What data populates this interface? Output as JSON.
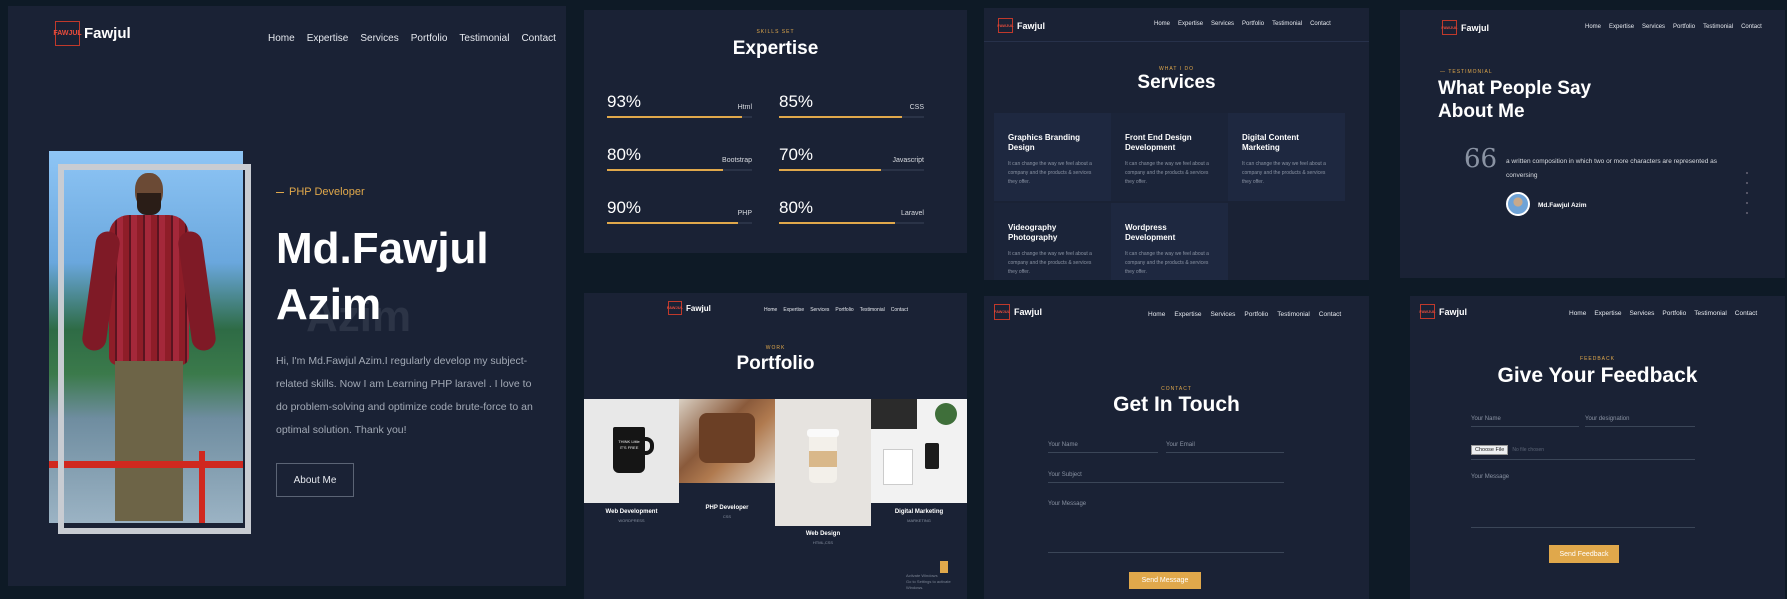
{
  "brand": {
    "logo_mark": "FAWJUL",
    "name": "Fawjul"
  },
  "nav": [
    "Home",
    "Expertise",
    "Services",
    "Portfolio",
    "Testimonial",
    "Contact"
  ],
  "hero": {
    "kicker": "PHP Developer",
    "name_line1": "Md.Fawjul",
    "name_line2": "Azim",
    "name_shadow": "Azim",
    "bio_lines": [
      "Hi, I'm Md.Fawjul Azim.I regularly develop my subject-",
      "related skills. Now I am Learning PHP laravel . I love to",
      "do problem-solving and optimize code brute-force to an",
      "optimal solution. Thank you!"
    ],
    "button": "About Me"
  },
  "expertise": {
    "kicker": "SKILLS SET",
    "title": "Expertise",
    "skills": [
      {
        "percent": "93%",
        "name": "Html",
        "level": 0.93
      },
      {
        "percent": "85%",
        "name": "CSS",
        "level": 0.85
      },
      {
        "percent": "80%",
        "name": "Bootstrap",
        "level": 0.8
      },
      {
        "percent": "70%",
        "name": "Javascript",
        "level": 0.7
      },
      {
        "percent": "90%",
        "name": "PHP",
        "level": 0.9
      },
      {
        "percent": "80%",
        "name": "Laravel",
        "level": 0.8
      }
    ]
  },
  "services": {
    "kicker": "WHAT I DO",
    "title": "Services",
    "items": [
      {
        "title_l1": "Graphics Branding",
        "title_l2": "Design",
        "desc_l1": "It can change the way we feel about a",
        "desc_l2": "company and the products & services",
        "desc_l3": "they offer."
      },
      {
        "title_l1": "Front End Design",
        "title_l2": "Development",
        "desc_l1": "It can change the way we feel about a",
        "desc_l2": "company and the products & services",
        "desc_l3": "they offer."
      },
      {
        "title_l1": "Digital Content",
        "title_l2": "Marketing",
        "desc_l1": "It can change the way we feel about a",
        "desc_l2": "company and the products & services",
        "desc_l3": "they offer."
      },
      {
        "title_l1": "Videography",
        "title_l2": "Photography",
        "desc_l1": "It can change the way we feel about a",
        "desc_l2": "company and the products & services",
        "desc_l3": "they offer."
      },
      {
        "title_l1": "Wordpress",
        "title_l2": "Development",
        "desc_l1": "It can change the way we feel about a",
        "desc_l2": "company and the products & services",
        "desc_l3": "they offer."
      }
    ]
  },
  "testimonial": {
    "kicker": "TESTIMONIAL",
    "title_l1": "What People Say",
    "title_l2": "About Me",
    "quote_mark": "66",
    "quote_l1": "a written composition in which two or more characters are represented as",
    "quote_l2": "conversing",
    "author": "Md.Fawjul Azim"
  },
  "portfolio": {
    "kicker": "WORK",
    "title": "Portfolio",
    "items": [
      {
        "title": "Web Development",
        "sub": "WORDPRESS",
        "mug_text": "THINK Little IT'S FREE"
      },
      {
        "title": "PHP Developer",
        "sub": "CSS"
      },
      {
        "title": "Web Design",
        "sub": "HTML,CSS"
      },
      {
        "title": "Digital Marketing",
        "sub": "MARKETING"
      }
    ],
    "watermark_l1": "Activate Windows",
    "watermark_l2": "Go to Settings to activate Windows."
  },
  "contact": {
    "kicker": "CONTACT",
    "title": "Get In Touch",
    "name_placeholder": "Your Name",
    "email_placeholder": "Your Email",
    "subject_placeholder": "Your Subject",
    "message_placeholder": "Your Message",
    "button": "Send Message"
  },
  "feedback": {
    "kicker": "FEEDBACK",
    "title": "Give Your Feedback",
    "name_placeholder": "Your Name",
    "designation_placeholder": "Your designation",
    "file_button": "Choose File",
    "file_status": "No file chosen",
    "message_placeholder": "Your Message",
    "button": "Send Feedback"
  },
  "colors": {
    "background": "#0e1a26",
    "panel": "#1a2235",
    "accent": "#e0a84b",
    "logo_red": "#e74c3c"
  }
}
